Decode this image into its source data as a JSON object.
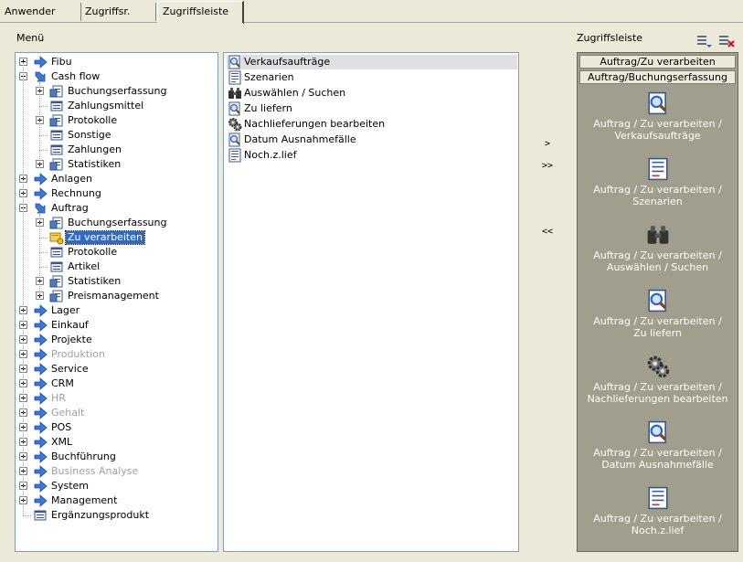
{
  "tabs": [
    {
      "label": "Anwender"
    },
    {
      "label": "Zugriffsr."
    },
    {
      "label": "Zugriffsleiste"
    }
  ],
  "menu_label": "Menü",
  "zugriffsleiste_label": "Zugriffsleiste",
  "toolbar": {
    "icon_add": "list-add-icon",
    "icon_remove": "list-remove-icon"
  },
  "tree": [
    {
      "label": "Fibu",
      "level": 0,
      "expander": "plus",
      "icon": "arrow-icon",
      "disabled": false
    },
    {
      "label": "Cash flow",
      "level": 0,
      "expander": "minus",
      "icon": "arrow-down-icon",
      "disabled": false
    },
    {
      "label": "Buchungserfassung",
      "level": 1,
      "expander": "plus",
      "icon": "folder-doc-icon",
      "disabled": false
    },
    {
      "label": "Zahlungsmittel",
      "level": 1,
      "expander": "none",
      "icon": "doc-icon",
      "disabled": false
    },
    {
      "label": "Protokolle",
      "level": 1,
      "expander": "plus",
      "icon": "folder-doc-icon",
      "disabled": false
    },
    {
      "label": "Sonstige",
      "level": 1,
      "expander": "none",
      "icon": "doc-icon",
      "disabled": false
    },
    {
      "label": "Zahlungen",
      "level": 1,
      "expander": "none",
      "icon": "doc-icon",
      "disabled": false
    },
    {
      "label": "Statistiken",
      "level": 1,
      "expander": "plus",
      "icon": "folder-doc-icon",
      "disabled": false
    },
    {
      "label": "Anlagen",
      "level": 0,
      "expander": "plus",
      "icon": "arrow-icon",
      "disabled": false
    },
    {
      "label": "Rechnung",
      "level": 0,
      "expander": "plus",
      "icon": "arrow-icon",
      "disabled": false
    },
    {
      "label": "Auftrag",
      "level": 0,
      "expander": "minus",
      "icon": "arrow-down-icon",
      "disabled": false
    },
    {
      "label": "Buchungserfassung",
      "level": 1,
      "expander": "plus",
      "icon": "folder-doc-icon",
      "disabled": false
    },
    {
      "label": "Zu verarbeiten",
      "level": 1,
      "expander": "none",
      "icon": "folder-open-icon",
      "disabled": false,
      "selected": true
    },
    {
      "label": "Protokolle",
      "level": 1,
      "expander": "none",
      "icon": "doc-icon",
      "disabled": false
    },
    {
      "label": "Artikel",
      "level": 1,
      "expander": "none",
      "icon": "doc-icon",
      "disabled": false
    },
    {
      "label": "Statistiken",
      "level": 1,
      "expander": "plus",
      "icon": "folder-doc-icon",
      "disabled": false
    },
    {
      "label": "Preismanagement",
      "level": 1,
      "expander": "plus",
      "icon": "folder-doc-icon",
      "disabled": false
    },
    {
      "label": "Lager",
      "level": 0,
      "expander": "plus",
      "icon": "arrow-icon",
      "disabled": false
    },
    {
      "label": "Einkauf",
      "level": 0,
      "expander": "plus",
      "icon": "arrow-icon",
      "disabled": false
    },
    {
      "label": "Projekte",
      "level": 0,
      "expander": "plus",
      "icon": "arrow-icon",
      "disabled": false
    },
    {
      "label": "Produktion",
      "level": 0,
      "expander": "plus",
      "icon": "arrow-icon",
      "disabled": true
    },
    {
      "label": "Service",
      "level": 0,
      "expander": "plus",
      "icon": "arrow-icon",
      "disabled": false
    },
    {
      "label": "CRM",
      "level": 0,
      "expander": "plus",
      "icon": "arrow-icon",
      "disabled": false
    },
    {
      "label": "HR",
      "level": 0,
      "expander": "plus",
      "icon": "arrow-icon",
      "disabled": true
    },
    {
      "label": "Gehalt",
      "level": 0,
      "expander": "plus",
      "icon": "arrow-icon",
      "disabled": true
    },
    {
      "label": "POS",
      "level": 0,
      "expander": "plus",
      "icon": "arrow-icon",
      "disabled": false
    },
    {
      "label": "XML",
      "level": 0,
      "expander": "plus",
      "icon": "arrow-icon",
      "disabled": false
    },
    {
      "label": "Buchführung",
      "level": 0,
      "expander": "plus",
      "icon": "arrow-icon",
      "disabled": false
    },
    {
      "label": "Business Analyse",
      "level": 0,
      "expander": "plus",
      "icon": "arrow-icon",
      "disabled": true
    },
    {
      "label": "System",
      "level": 0,
      "expander": "plus",
      "icon": "arrow-icon",
      "disabled": false
    },
    {
      "label": "Management",
      "level": 0,
      "expander": "plus",
      "icon": "arrow-icon",
      "disabled": false
    },
    {
      "label": "Ergänzungsprodukt",
      "level": 0,
      "expander": "none",
      "icon": "doc-icon",
      "disabled": false
    }
  ],
  "list": [
    {
      "label": "Verkaufsaufträge",
      "icon": "magnifier-doc-icon"
    },
    {
      "label": "Szenarien",
      "icon": "report-icon"
    },
    {
      "label": "Auswählen / Suchen",
      "icon": "binoculars-icon"
    },
    {
      "label": "Zu liefern",
      "icon": "magnifier-doc-icon"
    },
    {
      "label": "Nachlieferungen bearbeiten",
      "icon": "gears-icon"
    },
    {
      "label": "Datum Ausnahmefälle",
      "icon": "magnifier-doc-icon"
    },
    {
      "label": "Noch.z.lief",
      "icon": "report-icon"
    }
  ],
  "buttons": {
    "add": ">",
    "add_all": ">>",
    "remove_all": "<<"
  },
  "right_headers": [
    "Auftrag/Zu verarbeiten",
    "Auftrag/Buchungserfassung"
  ],
  "right_items": [
    {
      "line1": "Auftrag / Zu verarbeiten /",
      "line2": "Verkaufsaufträge",
      "icon": "magnifier-doc-icon"
    },
    {
      "line1": "Auftrag / Zu verarbeiten /",
      "line2": "Szenarien",
      "icon": "report-icon"
    },
    {
      "line1": "Auftrag / Zu verarbeiten /",
      "line2": "Auswählen / Suchen",
      "icon": "binoculars-icon"
    },
    {
      "line1": "Auftrag / Zu verarbeiten /",
      "line2": "Zu liefern",
      "icon": "magnifier-doc-icon"
    },
    {
      "line1": "Auftrag / Zu verarbeiten /",
      "line2": "Nachlieferungen bearbeiten",
      "icon": "gears-icon"
    },
    {
      "line1": "Auftrag / Zu verarbeiten /",
      "line2": "Datum Ausnahmefälle",
      "icon": "magnifier-doc-icon"
    },
    {
      "line1": "Auftrag / Zu verarbeiten /",
      "line2": "Noch.z.lief",
      "icon": "report-icon"
    }
  ]
}
